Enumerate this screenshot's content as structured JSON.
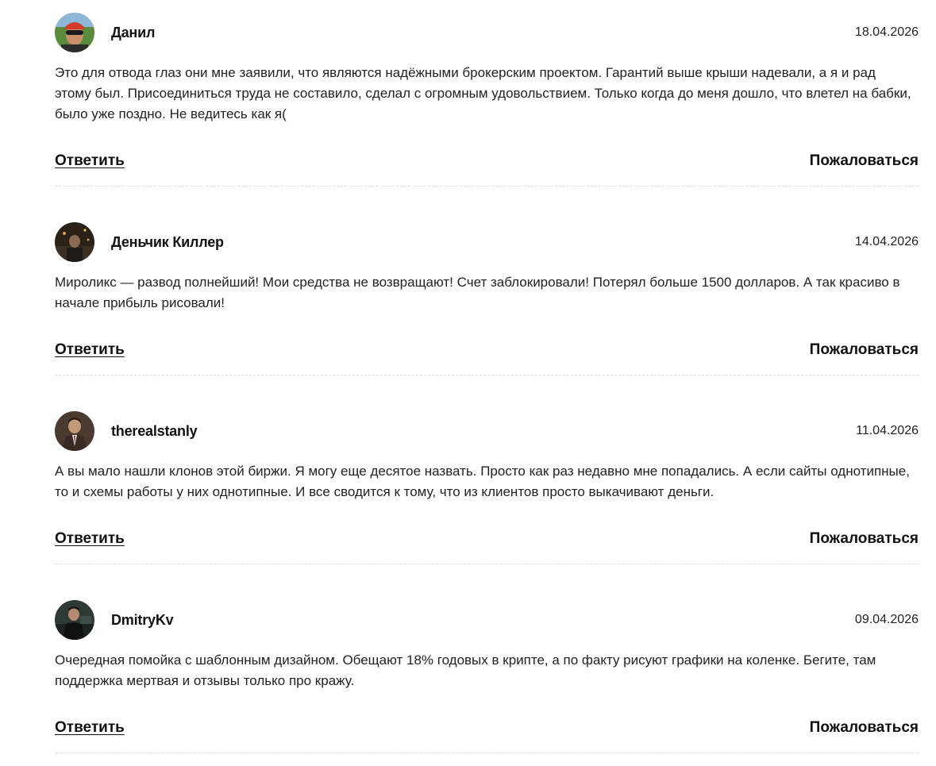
{
  "comments": [
    {
      "author": "Данил",
      "date": "18.04.2026",
      "text": "Это для отвода глаз они мне заявили, что являются надёжными брокерским проектом. Гарантий выше крыши надевали, а я и рад этому был. Присоединиться труда не составило, сделал с огромным удовольствием. Только когда до меня дошло, что влетел на бабки, было уже поздно. Не ведитесь как я(",
      "reply_label": "Ответить",
      "complain_label": "Пожаловаться"
    },
    {
      "author": "Деньчик Киллер",
      "date": "14.04.2026",
      "text": "Мироликс — развод полнейший! Мои средства не возвращают! Счет заблокировали! Потерял больше 1500 долларов. А так красиво в начале прибыль рисовали!",
      "reply_label": "Ответить",
      "complain_label": "Пожаловаться"
    },
    {
      "author": "therealstanly",
      "date": "11.04.2026",
      "text": "А вы мало нашли клонов этой биржи. Я могу еще десятое назвать. Просто как раз недавно мне попадались. А если сайты однотипные, то и схемы работы у них однотипные. И все сводится к тому, что из клиентов просто выкачивают деньги.",
      "reply_label": "Ответить",
      "complain_label": "Пожаловаться"
    },
    {
      "author": "DmitryKv",
      "date": "09.04.2026",
      "text": "Очередная помойка с шаблонным дизайном. Обещают 18% годовых в крипте, а по факту рисуют графики на коленке. Бегите, там поддержка мертвая и отзывы только про кражу.",
      "reply_label": "Ответить",
      "complain_label": "Пожаловаться"
    }
  ]
}
